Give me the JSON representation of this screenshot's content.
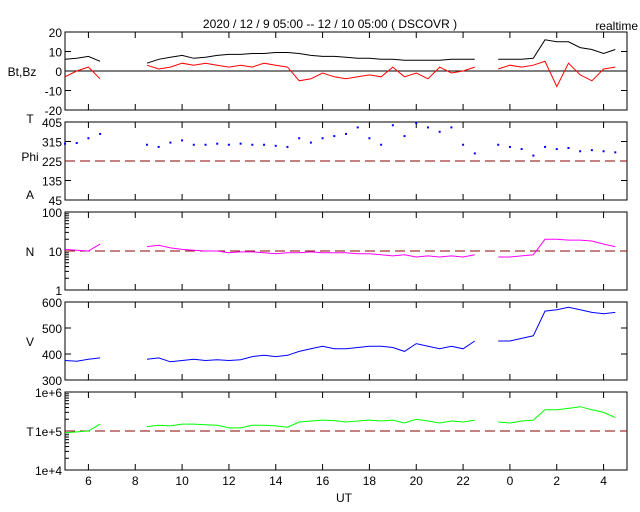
{
  "chart_data": {
    "type": "line",
    "title": "2020 / 12 / 9   05:00 -- 12 / 10   05:00 ( DSCOVR )",
    "mode_label": "realtime",
    "xlabel": "UT",
    "x_hours_from_start": [
      0,
      0.5,
      1,
      1.5,
      2,
      2.5,
      3,
      3.5,
      4,
      4.5,
      5,
      5.5,
      6,
      6.5,
      7,
      7.5,
      8,
      8.5,
      9,
      9.5,
      10,
      10.5,
      11,
      11.5,
      12,
      12.5,
      13,
      13.5,
      14,
      14.5,
      15,
      15.5,
      16,
      16.5,
      17,
      17.5,
      18,
      18.5,
      19,
      19.5,
      20,
      20.5,
      21,
      21.5,
      22,
      22.5,
      23,
      23.5
    ],
    "xlim_hours": [
      0,
      24
    ],
    "x_ticks": [
      {
        "h": 1,
        "label": "6"
      },
      {
        "h": 3,
        "label": "8"
      },
      {
        "h": 5,
        "label": "10"
      },
      {
        "h": 7,
        "label": "12"
      },
      {
        "h": 9,
        "label": "14"
      },
      {
        "h": 11,
        "label": "16"
      },
      {
        "h": 13,
        "label": "18"
      },
      {
        "h": 15,
        "label": "20"
      },
      {
        "h": 17,
        "label": "22"
      },
      {
        "h": 19,
        "label": "0"
      },
      {
        "h": 21,
        "label": "2"
      },
      {
        "h": 23,
        "label": "4"
      }
    ],
    "panels": [
      {
        "id": "bt-bz",
        "ylabel": [
          "Bt,Bz"
        ],
        "scale": "linear",
        "ylim": [
          -20,
          20
        ],
        "yticks": [
          {
            "v": 20,
            "label": "20"
          },
          {
            "v": 10,
            "label": "10"
          },
          {
            "v": 0,
            "label": "0"
          },
          {
            "v": -10,
            "label": "-10"
          },
          {
            "v": -20,
            "label": "-20"
          }
        ],
        "refline": {
          "v": 0,
          "style": "solid",
          "color": "#000000"
        },
        "series": [
          {
            "name": "Bt",
            "color": "#000000",
            "kind": "line",
            "values": [
              6,
              6.5,
              7.5,
              5,
              null,
              null,
              null,
              4,
              6,
              7,
              8,
              6.5,
              7,
              8,
              8.5,
              8.5,
              9,
              9,
              9.5,
              9.5,
              9,
              8,
              7.5,
              7.5,
              7,
              6.5,
              6.5,
              6,
              6,
              5.5,
              5.5,
              5.5,
              5.5,
              6,
              6,
              6,
              null,
              6,
              6,
              6,
              6.5,
              16,
              15,
              15,
              12,
              11,
              9,
              11
            ]
          },
          {
            "name": "Bz",
            "color": "#ff0000",
            "kind": "line",
            "values": [
              -3,
              0,
              2,
              -4,
              null,
              null,
              null,
              3,
              1,
              2,
              4,
              3,
              4,
              3,
              2,
              3,
              2,
              4,
              3,
              2,
              -5,
              -4,
              -1,
              -3,
              -4,
              -3,
              -2,
              -3,
              2,
              -3,
              -1,
              -4,
              2,
              -1,
              0,
              2,
              null,
              1,
              3,
              2,
              3,
              5,
              -8,
              4,
              -2,
              -5,
              1,
              2
            ]
          }
        ]
      },
      {
        "id": "phi",
        "ylabel": [
          "T",
          "Phi",
          "A"
        ],
        "scale": "linear",
        "ylim": [
          45,
          405
        ],
        "yticks": [
          {
            "v": 405,
            "label": "405"
          },
          {
            "v": 315,
            "label": "315"
          },
          {
            "v": 225,
            "label": "225"
          },
          {
            "v": 135,
            "label": "135"
          },
          {
            "v": 45,
            "label": "45"
          }
        ],
        "refline": {
          "v": 225,
          "style": "dashed",
          "color": "#8b0000"
        },
        "series": [
          {
            "name": "Phi",
            "color": "#0000ff",
            "kind": "scatter",
            "values": [
              305,
              308,
              330,
              350,
              null,
              null,
              null,
              300,
              290,
              310,
              320,
              300,
              300,
              305,
              300,
              305,
              300,
              300,
              295,
              290,
              330,
              310,
              330,
              340,
              350,
              380,
              330,
              300,
              390,
              340,
              400,
              380,
              360,
              380,
              300,
              260,
              null,
              300,
              290,
              280,
              250,
              290,
              280,
              285,
              270,
              275,
              270,
              265
            ]
          }
        ]
      },
      {
        "id": "density",
        "ylabel": [
          "N"
        ],
        "scale": "log",
        "ylim": [
          1,
          100
        ],
        "yticks": [
          {
            "v": 100,
            "label": "100"
          },
          {
            "v": 10,
            "label": "10"
          },
          {
            "v": 1,
            "label": "1"
          }
        ],
        "refline": {
          "v": 10,
          "style": "dashed",
          "color": "#8b0000"
        },
        "series": [
          {
            "name": "N",
            "color": "#ff00ff",
            "kind": "line",
            "values": [
              11,
              10.5,
              10,
              15,
              null,
              null,
              null,
              13,
              14,
              12,
              11,
              10.5,
              10,
              10,
              9,
              9.5,
              9.5,
              9,
              8.5,
              9,
              9,
              9.5,
              9,
              9,
              9,
              8.5,
              8.5,
              8,
              7.5,
              8,
              7,
              7.5,
              7,
              7.5,
              7,
              8,
              null,
              7,
              7,
              7.5,
              8,
              20,
              20,
              19,
              19,
              18,
              15,
              13
            ]
          }
        ]
      },
      {
        "id": "speed",
        "ylabel": [
          "V"
        ],
        "scale": "linear",
        "ylim": [
          300,
          600
        ],
        "yticks": [
          {
            "v": 600,
            "label": "600"
          },
          {
            "v": 500,
            "label": "500"
          },
          {
            "v": 400,
            "label": "400"
          },
          {
            "v": 300,
            "label": "300"
          }
        ],
        "refline": null,
        "series": [
          {
            "name": "V",
            "color": "#0000ff",
            "kind": "line",
            "values": [
              375,
              372,
              380,
              385,
              null,
              null,
              null,
              380,
              385,
              370,
              375,
              380,
              375,
              378,
              375,
              378,
              390,
              395,
              390,
              395,
              410,
              420,
              430,
              420,
              420,
              425,
              430,
              430,
              425,
              410,
              440,
              430,
              420,
              430,
              420,
              450,
              null,
              450,
              450,
              460,
              470,
              565,
              570,
              580,
              570,
              560,
              555,
              560
            ]
          }
        ]
      },
      {
        "id": "temperature",
        "ylabel": [
          "T"
        ],
        "scale": "log",
        "ylim": [
          10000,
          1000000
        ],
        "yticks": [
          {
            "v": 1000000,
            "label": "1e+6"
          },
          {
            "v": 100000,
            "label": "1e+5"
          },
          {
            "v": 10000,
            "label": "1e+4"
          }
        ],
        "refline": {
          "v": 100000,
          "style": "dashed",
          "color": "#8b0000"
        },
        "series": [
          {
            "name": "T",
            "color": "#00ff00",
            "kind": "line",
            "values": [
              90000,
              95000,
              100000,
              150000,
              null,
              null,
              null,
              130000,
              140000,
              135000,
              150000,
              150000,
              145000,
              140000,
              120000,
              120000,
              140000,
              140000,
              135000,
              125000,
              170000,
              180000,
              190000,
              185000,
              170000,
              180000,
              190000,
              180000,
              190000,
              160000,
              200000,
              180000,
              160000,
              180000,
              170000,
              190000,
              null,
              170000,
              160000,
              180000,
              190000,
              350000,
              350000,
              380000,
              420000,
              350000,
              300000,
              220000
            ]
          }
        ]
      }
    ]
  }
}
